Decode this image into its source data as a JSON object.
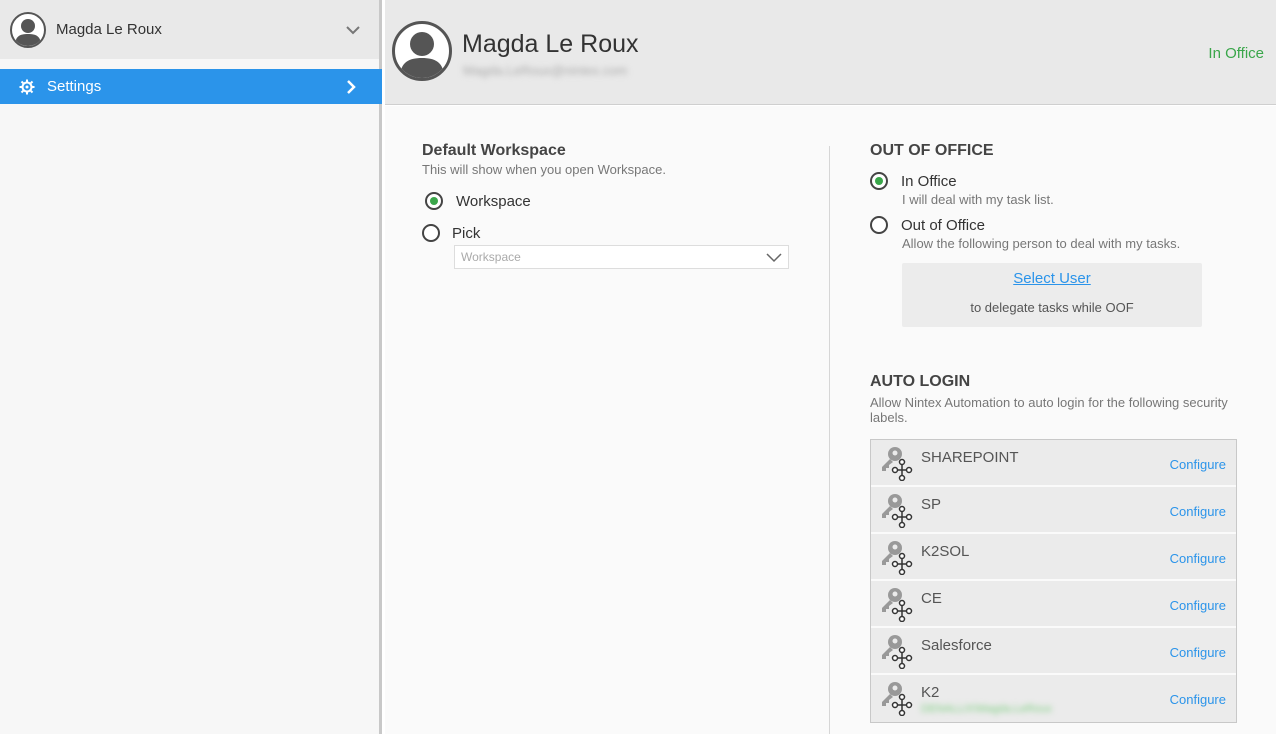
{
  "sidebar": {
    "user_name": "Magda Le Roux",
    "settings_label": "Settings"
  },
  "header": {
    "name": "Magda Le Roux",
    "email": "Magda.LeRoux@nintex.com",
    "status": "In Office"
  },
  "default_workspace": {
    "title": "Default Workspace",
    "description": "This will show when you open Workspace.",
    "options": [
      "Workspace",
      "Pick"
    ],
    "selected": "Workspace",
    "select_placeholder": "Workspace"
  },
  "out_of_office": {
    "title": "OUT OF OFFICE",
    "in_office_label": "In Office",
    "in_office_desc": "I will deal with my task list.",
    "out_office_label": "Out of Office",
    "out_office_desc": "Allow the following person to deal with my tasks.",
    "select_user_link": "Select User",
    "delegate_note": "to delegate tasks while OOF",
    "selected": "In Office"
  },
  "auto_login": {
    "title": "AUTO LOGIN",
    "description": "Allow Nintex Automation to auto login for the following security labels.",
    "configure_label": "Configure",
    "labels": [
      {
        "name": "SHAREPOINT",
        "sub": ""
      },
      {
        "name": "SP",
        "sub": ""
      },
      {
        "name": "K2SOL",
        "sub": ""
      },
      {
        "name": "CE",
        "sub": ""
      },
      {
        "name": "Salesforce",
        "sub": ""
      },
      {
        "name": "K2",
        "sub": "DENALLIX\\Magda.LeRoux"
      }
    ]
  },
  "colors": {
    "accent": "#2b94ea",
    "status_green": "#3aa64a"
  },
  "icons": {
    "user_avatar": "person-silhouette-icon",
    "settings": "gear-icon",
    "security_label": "key-network-icon"
  }
}
